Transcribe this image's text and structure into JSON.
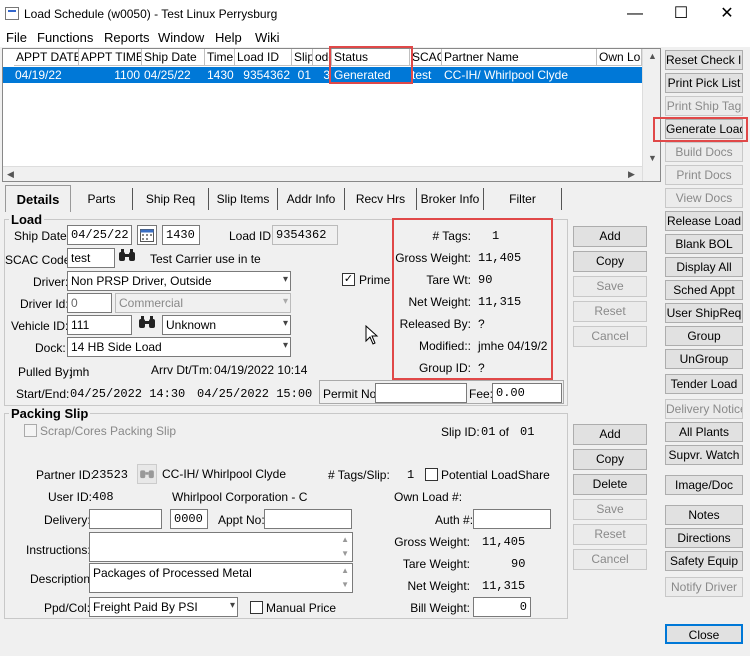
{
  "window": {
    "title": "Load Schedule (w0050) - Test Linux Perrysburg",
    "min": "—",
    "max": "☐",
    "close": "✕"
  },
  "menu": [
    "File",
    "Functions",
    "Reports",
    "Window",
    "Help",
    "Wiki"
  ],
  "grid": {
    "columns": [
      "APPT DATE",
      "APPT TIME",
      "Ship Date",
      "Time",
      "Load ID",
      "Slip",
      "ode",
      "Status",
      "SCAC",
      "Partner Name",
      "Own Loa"
    ],
    "row": [
      "04/19/22",
      "1100",
      "04/25/22",
      "1430",
      "9354362",
      "01",
      "3",
      "Generated",
      "test",
      "CC-IH/ Whirlpool Clyde",
      ""
    ]
  },
  "tabs": [
    "Details",
    "Parts",
    "Ship Req",
    "Slip Items",
    "Addr Info",
    "Recv Hrs",
    "Broker Info",
    "Filter"
  ],
  "load": {
    "group_label": "Load",
    "ship_date_label": "Ship Date:",
    "ship_date": "04/25/22",
    "ship_time": "1430",
    "load_id_label": "Load ID:",
    "load_id": "9354362",
    "scac_label": "SCAC Code:",
    "scac": "test",
    "carrier_note": "Test Carrier use in te",
    "driver_label": "Driver:",
    "driver": "Non PRSP Driver, Outside",
    "prime_label": "Prime",
    "driver_id_label": "Driver Id:",
    "driver_id": "0",
    "driver_type": "Commercial",
    "vehicle_label": "Vehicle ID:",
    "vehicle_id": "111",
    "vehicle_type": "Unknown",
    "dock_label": "Dock:",
    "dock": "14 HB Side Load",
    "pulled_by_label": "Pulled By:",
    "pulled_by": "jmh",
    "arrv_label": "Arrv Dt/Tm:",
    "arrv": "04/19/2022 10:14",
    "start_end_label": "Start/End:",
    "start": "04/25/2022 14:30",
    "end": "04/25/2022 15:00",
    "permit_label": "Permit No:",
    "permit": "",
    "fee_label": "Fee:",
    "fee": "0.00",
    "summary": {
      "tags_label": "# Tags:",
      "tags": "1",
      "gross_label": "Gross Weight:",
      "gross": "11,405",
      "tare_label": "Tare Wt:",
      "tare": "90",
      "net_label": "Net Weight:",
      "net": "11,315",
      "released_label": "Released By:",
      "released": "?",
      "modified_label": "Modified::",
      "modified": "jmhe 04/19/2",
      "group_id_label": "Group ID:",
      "group_id": "?"
    },
    "buttons": [
      "Add",
      "Copy",
      "Save",
      "Reset",
      "Cancel"
    ]
  },
  "packing": {
    "group_label": "Packing Slip",
    "scrap_label": "Scrap/Cores Packing Slip",
    "slip_id_label": "Slip ID:",
    "slip_id": "01",
    "of_label": "of",
    "slip_total": "01",
    "partner_label": "Partner ID:",
    "partner_id": "23523",
    "partner_name": "CC-IH/ Whirlpool Clyde",
    "tags_slip_label": "# Tags/Slip:",
    "tags_slip": "1",
    "potential_label": "Potential LoadShare",
    "user_label": "User ID:",
    "user_id": "408",
    "user_name": "Whirlpool Corporation - C",
    "own_load_label": "Own Load #:",
    "delivery_label": "Delivery:",
    "delivery": "",
    "delivery_time": "0000",
    "appt_label": "Appt No:",
    "appt": "",
    "auth_label": "Auth #:",
    "auth": "",
    "instructions_label": "Instructions:",
    "instructions": "",
    "description_label": "Description:",
    "description": "Packages of Processed Metal",
    "gross_label": "Gross Weight:",
    "gross": "11,405",
    "tare_label": "Tare Weight:",
    "tare": "90",
    "net_label": "Net Weight:",
    "net": "11,315",
    "ppd_label": "Ppd/Col:",
    "ppd": "Freight Paid By PSI",
    "manual_label": "Manual Price",
    "bill_label": "Bill Weight:",
    "bill": "0",
    "buttons": [
      "Add",
      "Copy",
      "Delete",
      "Save",
      "Reset",
      "Cancel"
    ]
  },
  "side": [
    "Reset Check In",
    "Print Pick List",
    "Print Ship Tag",
    "Generate Load",
    "Build Docs",
    "Print Docs",
    "View Docs",
    "Release Load",
    "Blank BOL",
    "Display All",
    "Sched Appt",
    "User ShipReq",
    "Group",
    "UnGroup",
    "Tender Load",
    "Delivery Notice",
    "All Plants",
    "Supvr. Watch",
    "Image/Doc",
    "Notes",
    "Directions",
    "Safety Equip",
    "Notify Driver",
    "Close"
  ]
}
